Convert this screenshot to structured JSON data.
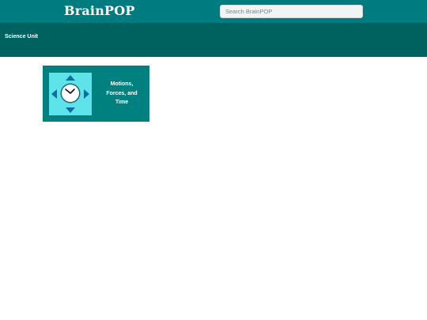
{
  "header": {
    "logo_text": "BrainPOP",
    "search_placeholder": "Search BrainPOP",
    "search_value": ""
  },
  "subheader": {
    "title": "Science Unit"
  },
  "cards": [
    {
      "label_lines": [
        "Motions,",
        "Forces, and",
        "Time"
      ],
      "icon": "clock-with-arrows-icon"
    }
  ],
  "colors": {
    "header_bg": "#007c80",
    "subheader_bg": "#00625f",
    "card_bg": "#00817f",
    "icon_bg": "#5fe3ea",
    "icon_arrows": "#0d6f9d"
  }
}
